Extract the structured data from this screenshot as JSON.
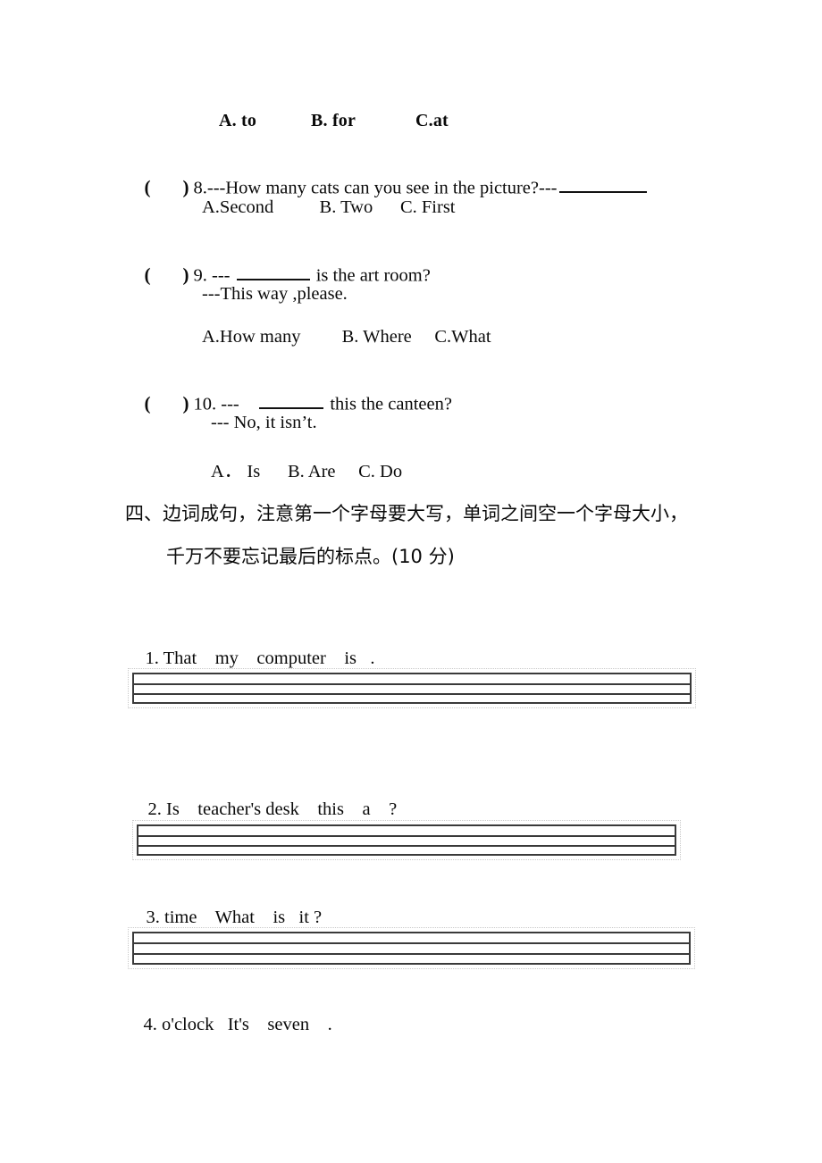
{
  "page": {
    "background_color": "#ffffff",
    "text_color": "#0a0a0a",
    "rule_color": "#3a3a3a",
    "border_color": "#c9c9c9"
  },
  "carryover_choices": {
    "a": "A. to",
    "b": "B. for",
    "c": "C.at"
  },
  "multiple_choice": [
    {
      "bracket_open": "(",
      "bracket_close": ")",
      "number": "8.",
      "stem_before": "---How many cats can you see in the picture?---",
      "stem_after": "",
      "has_blank": true,
      "blank_position": "end",
      "choices": "A.Second          B. Two      C. First"
    },
    {
      "bracket_open": "(",
      "bracket_close": ")",
      "number": "9.",
      "stem_before": " --- ",
      "stem_after": " is the art room?",
      "has_blank": true,
      "blank_position": "middle",
      "answer_line": "---This way ,please.",
      "choices": "A.How many         B. Where     C.What"
    },
    {
      "bracket_open": "(",
      "bracket_close": ")",
      "number": "10.",
      "stem_before": " ---    ",
      "stem_after": " this the canteen?",
      "has_blank": true,
      "blank_position": "middle",
      "answer_line": "--- No, it isn’t.",
      "choices": "A． Is      B. Are     C. Do"
    }
  ],
  "section_four": {
    "heading_line_1": "四、边词成句，注意第一个字母要大写，单词之间空一个字母大小，",
    "heading_line_2": "千万不要忘记最后的标点。(10 分)",
    "items": [
      {
        "number": "1.",
        "words": "That    my    computer    is   ."
      },
      {
        "number": "2.",
        "words": "Is    teacher's desk    this    a    ?"
      },
      {
        "number": "3.",
        "words": "time    What    is   it ?"
      },
      {
        "number": "4.",
        "words": "o'clock   It's    seven    ."
      }
    ]
  }
}
